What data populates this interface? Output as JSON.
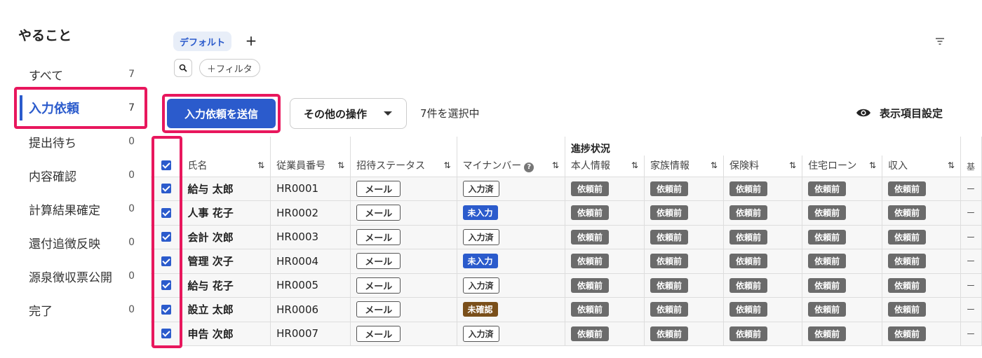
{
  "sidebar": {
    "title": "やること",
    "items": [
      {
        "label": "すべて",
        "count": "7"
      },
      {
        "label": "入力依頼",
        "count": "7"
      },
      {
        "label": "提出待ち",
        "count": "0"
      },
      {
        "label": "内容確認",
        "count": "0"
      },
      {
        "label": "計算結果確定",
        "count": "0"
      },
      {
        "label": "還付追徴反映",
        "count": "0"
      },
      {
        "label": "源泉徴収票公開",
        "count": "0"
      },
      {
        "label": "完了",
        "count": "0"
      }
    ]
  },
  "filters": {
    "default_tab": "デフォルト",
    "add_tab": "+",
    "filter_label": "＋フィルタ"
  },
  "actions": {
    "primary": "入力依頼を送信",
    "other": "その他の操作",
    "selected": "7件を選択中",
    "display_settings": "表示項目設定"
  },
  "table": {
    "group_header": "進捗状況",
    "columns": {
      "name": "氏名",
      "employee_no": "従業員番号",
      "invite_status": "招待ステータス",
      "my_number": "マイナンバー",
      "self_info": "本人情報",
      "family_info": "家族情報",
      "insurance": "保険料",
      "housing_loan": "住宅ローン",
      "income": "収入",
      "extra": "基"
    },
    "rows": [
      {
        "name": "給与 太郎",
        "employee_no": "HR0001",
        "invite": "メール",
        "my_number": "入力済",
        "my_number_state": "done",
        "self": "依頼前",
        "family": "依頼前",
        "insurance": "依頼前",
        "loan": "依頼前",
        "income": "依頼前",
        "extra": "ー"
      },
      {
        "name": "人事 花子",
        "employee_no": "HR0002",
        "invite": "メール",
        "my_number": "未入力",
        "my_number_state": "not",
        "self": "依頼前",
        "family": "依頼前",
        "insurance": "依頼前",
        "loan": "依頼前",
        "income": "依頼前",
        "extra": "ー"
      },
      {
        "name": "会計 次郎",
        "employee_no": "HR0003",
        "invite": "メール",
        "my_number": "入力済",
        "my_number_state": "done",
        "self": "依頼前",
        "family": "依頼前",
        "insurance": "依頼前",
        "loan": "依頼前",
        "income": "依頼前",
        "extra": "ー"
      },
      {
        "name": "管理 次子",
        "employee_no": "HR0004",
        "invite": "メール",
        "my_number": "未入力",
        "my_number_state": "not",
        "self": "依頼前",
        "family": "依頼前",
        "insurance": "依頼前",
        "loan": "依頼前",
        "income": "依頼前",
        "extra": "ー"
      },
      {
        "name": "給与 花子",
        "employee_no": "HR0005",
        "invite": "メール",
        "my_number": "入力済",
        "my_number_state": "done",
        "self": "依頼前",
        "family": "依頼前",
        "insurance": "依頼前",
        "loan": "依頼前",
        "income": "依頼前",
        "extra": "ー"
      },
      {
        "name": "設立 太郎",
        "employee_no": "HR0006",
        "invite": "メール",
        "my_number": "未確認",
        "my_number_state": "unconf",
        "self": "依頼前",
        "family": "依頼前",
        "insurance": "依頼前",
        "loan": "依頼前",
        "income": "依頼前",
        "extra": "ー"
      },
      {
        "name": "申告 次郎",
        "employee_no": "HR0007",
        "invite": "メール",
        "my_number": "入力済",
        "my_number_state": "done",
        "self": "依頼前",
        "family": "依頼前",
        "insurance": "依頼前",
        "loan": "依頼前",
        "income": "依頼前",
        "extra": "ー"
      }
    ]
  },
  "colors": {
    "accent": "#2b5bcc",
    "highlight": "#e8175d",
    "badge_pre": "#6b6b6b",
    "badge_unconfirmed": "#7a4f1a"
  }
}
